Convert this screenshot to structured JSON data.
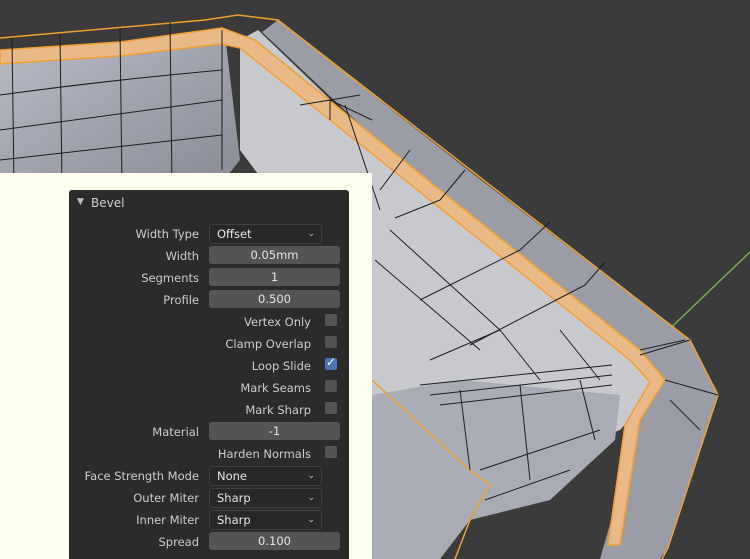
{
  "bevel": {
    "title": "Bevel",
    "width_type": {
      "label": "Width Type",
      "value": "Offset"
    },
    "width": {
      "label": "Width",
      "value": "0.05mm"
    },
    "segments": {
      "label": "Segments",
      "value": "1"
    },
    "profile": {
      "label": "Profile",
      "value": "0.500"
    },
    "vertex_only": {
      "label": "Vertex Only",
      "checked": false
    },
    "clamp_overlap": {
      "label": "Clamp Overlap",
      "checked": false
    },
    "loop_slide": {
      "label": "Loop Slide",
      "checked": true
    },
    "mark_seams": {
      "label": "Mark Seams",
      "checked": false
    },
    "mark_sharp": {
      "label": "Mark Sharp",
      "checked": false
    },
    "material": {
      "label": "Material",
      "value": "-1"
    },
    "harden_normals": {
      "label": "Harden Normals",
      "checked": false
    },
    "face_strength_mode": {
      "label": "Face Strength Mode",
      "value": "None"
    },
    "outer_miter": {
      "label": "Outer Miter",
      "value": "Sharp"
    },
    "inner_miter": {
      "label": "Inner Miter",
      "value": "Sharp"
    },
    "spread": {
      "label": "Spread",
      "value": "0.100"
    }
  },
  "colors": {
    "selection": "#f0a030",
    "panel": "#2b2b2b",
    "accent": "#4b74b8",
    "axis": "#7ea84e"
  },
  "icons": [
    "collapse-triangle-icon",
    "chevron-down-icon",
    "checkmark-icon"
  ]
}
